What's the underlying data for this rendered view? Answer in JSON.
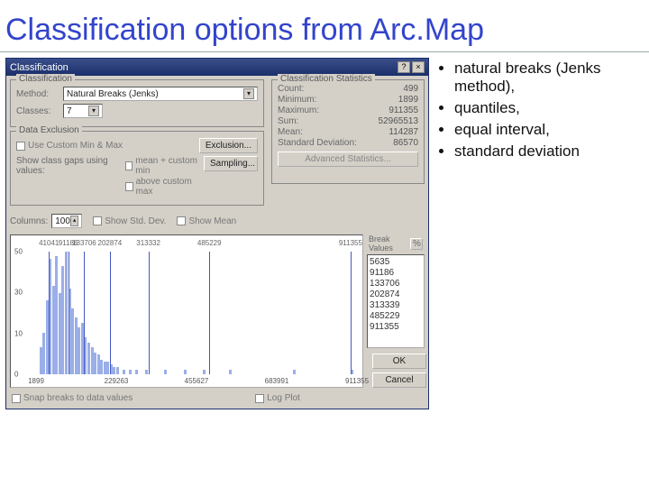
{
  "slide": {
    "title": "Classification options from Arc.Map"
  },
  "bullets": [
    "natural breaks (Jenks method),",
    "quantiles,",
    "equal interval,",
    "standard deviation"
  ],
  "dialog": {
    "title": "Classification",
    "help": "?",
    "close": "×",
    "classification": {
      "panel": "Classification",
      "method_label": "Method:",
      "method_value": "Natural Breaks (Jenks)",
      "classes_label": "Classes:",
      "classes_value": "7"
    },
    "stats": {
      "panel": "Classification Statistics",
      "rows": [
        {
          "k": "Count:",
          "v": "499"
        },
        {
          "k": "Minimum:",
          "v": "1899"
        },
        {
          "k": "Maximum:",
          "v": "911355"
        },
        {
          "k": "Sum:",
          "v": "52965513"
        },
        {
          "k": "Mean:",
          "v": "114287"
        },
        {
          "k": "Standard Deviation:",
          "v": "86570"
        }
      ],
      "adv": "Advanced Statistics..."
    },
    "excl": {
      "panel": "Data Exclusion",
      "use_custom": "Use Custom Min & Max",
      "show_class_gaps": "Show class gaps using values:",
      "mean_custom_min": "mean + custom min",
      "above_custom_max": "above custom max",
      "exclusion_btn": "Exclusion...",
      "sampling_btn": "Sampling..."
    },
    "hist_ctrl": {
      "columns_label": "Columns:",
      "columns_value": "100",
      "show_std": "Show Std. Dev.",
      "show_mean": "Show Mean"
    },
    "break_values": {
      "label": "Break Values",
      "pct": "%",
      "items": [
        "5635",
        "91186",
        "133706",
        "202874",
        "313339",
        "485229",
        "911355"
      ]
    },
    "chart": {
      "x_ticks": [
        "1899",
        "229263",
        "455627",
        "683991",
        "911355"
      ],
      "y_ticks": [
        "0",
        "10",
        "30",
        "50"
      ],
      "break_labels": [
        "41041",
        "91186",
        "133706",
        "202874",
        "313332",
        "485229",
        "911355"
      ],
      "break_pos_pct": [
        4,
        10,
        15,
        23,
        35,
        54,
        98
      ],
      "bars": [
        {
          "x": 1,
          "h": 22
        },
        {
          "x": 2,
          "h": 34
        },
        {
          "x": 3,
          "h": 60
        },
        {
          "x": 4,
          "h": 94
        },
        {
          "x": 5,
          "h": 72
        },
        {
          "x": 6,
          "h": 96
        },
        {
          "x": 7,
          "h": 66
        },
        {
          "x": 8,
          "h": 88
        },
        {
          "x": 9,
          "h": 100
        },
        {
          "x": 10,
          "h": 70
        },
        {
          "x": 11,
          "h": 54
        },
        {
          "x": 12,
          "h": 46
        },
        {
          "x": 13,
          "h": 38
        },
        {
          "x": 14,
          "h": 42
        },
        {
          "x": 15,
          "h": 30
        },
        {
          "x": 16,
          "h": 26
        },
        {
          "x": 17,
          "h": 22
        },
        {
          "x": 18,
          "h": 18
        },
        {
          "x": 19,
          "h": 16
        },
        {
          "x": 20,
          "h": 12
        },
        {
          "x": 21,
          "h": 10
        },
        {
          "x": 22,
          "h": 10
        },
        {
          "x": 23,
          "h": 8
        },
        {
          "x": 24,
          "h": 6
        },
        {
          "x": 25,
          "h": 6
        },
        {
          "x": 27,
          "h": 4
        },
        {
          "x": 29,
          "h": 4
        },
        {
          "x": 31,
          "h": 4
        },
        {
          "x": 34,
          "h": 4
        },
        {
          "x": 40,
          "h": 4
        },
        {
          "x": 46,
          "h": 4
        },
        {
          "x": 52,
          "h": 4
        },
        {
          "x": 60,
          "h": 4
        },
        {
          "x": 80,
          "h": 4
        },
        {
          "x": 98,
          "h": 4
        }
      ]
    },
    "bottom": {
      "snap": "Snap breaks to data values",
      "log": "Log Plot",
      "ok": "OK",
      "cancel": "Cancel"
    }
  }
}
